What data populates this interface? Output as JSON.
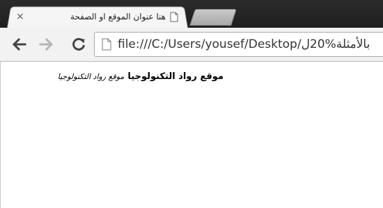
{
  "browser": {
    "tab": {
      "title": "هنا عنوان الموقع او الصفحة",
      "close_glyph": "×"
    },
    "address_bar": {
      "url": "file:///C:/Users/yousef/Desktop/بالأمثلة%20ل"
    },
    "icons": {
      "favicon": "page-icon",
      "back": "arrow-left-icon",
      "forward": "arrow-right-icon",
      "reload": "reload-icon",
      "omnibox_page": "page-icon"
    },
    "colors": {
      "tabstrip": "#2b2b2b",
      "toolbar": "#f2f2f2",
      "tab_active": "#f5f5f5"
    }
  },
  "page": {
    "bold_text": "موقع رواد التكنولوجيا",
    "italic_text": "موقع رواد التكنولوجيا"
  }
}
